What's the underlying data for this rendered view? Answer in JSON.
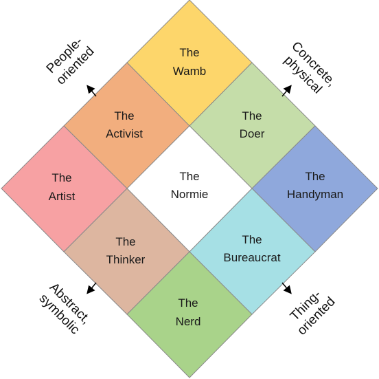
{
  "cells": [
    {
      "id": "wamb",
      "line1": "The",
      "line2": "Wamb",
      "color": "#FDD66B"
    },
    {
      "id": "activist",
      "line1": "The",
      "line2": "Activist",
      "color": "#F2AE7E"
    },
    {
      "id": "doer",
      "line1": "The",
      "line2": "Doer",
      "color": "#C5DDA9"
    },
    {
      "id": "artist",
      "line1": "The",
      "line2": "Artist",
      "color": "#F7A1A3"
    },
    {
      "id": "normie",
      "line1": "The",
      "line2": "Normie",
      "color": "#FFFFFF"
    },
    {
      "id": "handyman",
      "line1": "The",
      "line2": "Handyman",
      "color": "#8FA8DC"
    },
    {
      "id": "thinker",
      "line1": "The",
      "line2": "Thinker",
      "color": "#DDB6A0"
    },
    {
      "id": "bureaucrat",
      "line1": "The",
      "line2": "Bureaucrat",
      "color": "#A6E0E5"
    },
    {
      "id": "nerd",
      "line1": "The",
      "line2": "Nerd",
      "color": "#A9D38A"
    }
  ],
  "axes": {
    "people": {
      "line1": "People-",
      "line2": "oriented"
    },
    "concrete": {
      "line1": "Concrete,",
      "line2": "physical"
    },
    "abstract": {
      "line1": "Abstract,",
      "line2": "symbolic"
    },
    "thing": {
      "line1": "Thing-",
      "line2": "oriented"
    }
  },
  "border_color": "#8A8A8A"
}
